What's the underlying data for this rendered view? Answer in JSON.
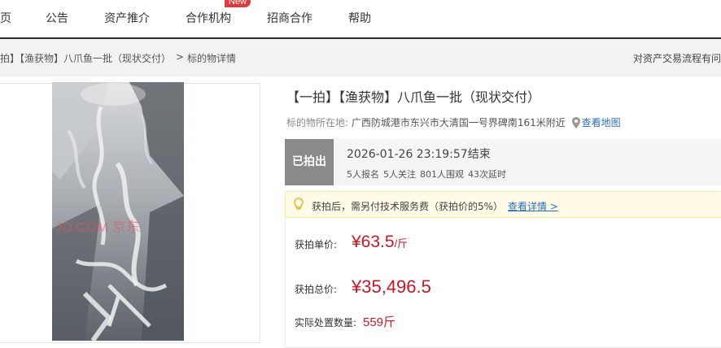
{
  "nav": {
    "items": [
      "页",
      "公告",
      "资产推介",
      "合作机构",
      "招商合作",
      "帮助"
    ],
    "new_badge": "New"
  },
  "breadcrumb": {
    "item_title": "拍】【渔获物】八爪鱼一批（现状交付）",
    "separator": ">",
    "current": "标的物详情",
    "right_link": "对资产交易流程有问"
  },
  "photo": {
    "watermark": "JD.COM 京东"
  },
  "product": {
    "title": "【一拍】【渔获物】八爪鱼一批（现状交付）",
    "location_label": "标的物所在地:",
    "location_value": "广西防城港市东兴市大清国一号界碑南161米附近",
    "map_link": "查看地图"
  },
  "status": {
    "badge": "已拍出",
    "end_time": "2026-01-26 23:19:57结束",
    "stats": [
      "5人报名",
      "5人关注",
      "801人围观",
      "43次延时"
    ]
  },
  "notice": {
    "icon": "bulb-icon",
    "text": "获拍后，需另付技术服务费（获拍价的5%）",
    "link": "查看详情 >"
  },
  "price": {
    "unit_price_label": "获拍单价:",
    "unit_price_value": "¥63.5",
    "unit_price_unit": "/斤",
    "total_price_label": "获拍总价:",
    "total_price_value": "¥35,496.5",
    "quantity_label": "实际处置数量:",
    "quantity_value": "559斤"
  },
  "colors": {
    "nav_rule": "#2b2b2b",
    "badge_red": "#e4393c",
    "price_red": "#c81623",
    "link_blue": "#2a6ebb",
    "status_gray": "#8a8a8a",
    "notice_bg": "#fffbe6"
  }
}
